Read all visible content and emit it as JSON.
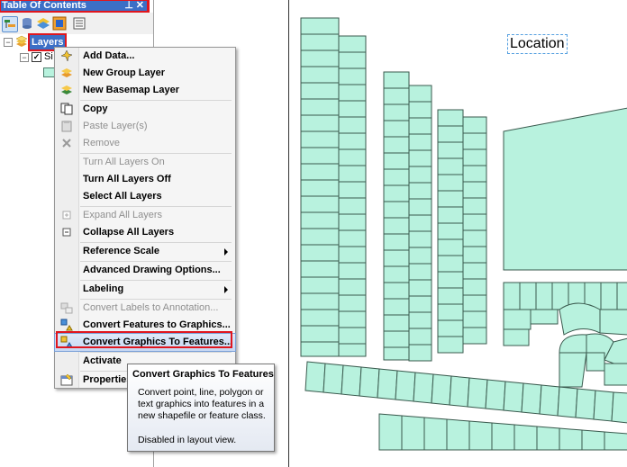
{
  "toc": {
    "title": "Table Of Contents",
    "pin_glyph": "⊥",
    "close_glyph": "✕",
    "toolbar_icons": [
      "list-by-drawing-order-icon",
      "list-by-source-icon",
      "list-by-visibility-icon",
      "list-by-selection-icon",
      "options-icon"
    ],
    "tree": {
      "layers_label": "Layers",
      "child_label": "Si",
      "expander_open": "−",
      "check_mark": "✓"
    }
  },
  "map": {
    "location_label": "Location",
    "parcel_fill": "#b8f2de",
    "parcel_stroke": "#3a5a4e"
  },
  "context_menu": {
    "items": [
      {
        "label": "Add Data...",
        "icon": "add-data-icon",
        "disabled": false
      },
      {
        "label": "New Group Layer",
        "icon": "group-layer-icon",
        "disabled": false
      },
      {
        "label": "New Basemap Layer",
        "icon": "basemap-layer-icon",
        "disabled": false
      },
      {
        "label": "Copy",
        "icon": "copy-icon",
        "disabled": false
      },
      {
        "label": "Paste Layer(s)",
        "icon": "paste-icon",
        "disabled": true
      },
      {
        "label": "Remove",
        "icon": "remove-icon",
        "disabled": true
      },
      {
        "label": "Turn All Layers On",
        "icon": "",
        "disabled": true
      },
      {
        "label": "Turn All Layers Off",
        "icon": "",
        "disabled": false
      },
      {
        "label": "Select All Layers",
        "icon": "",
        "disabled": false
      },
      {
        "label": "Expand All Layers",
        "icon": "expand-icon",
        "disabled": true
      },
      {
        "label": "Collapse All Layers",
        "icon": "collapse-icon",
        "disabled": false
      },
      {
        "label": "Reference Scale",
        "icon": "",
        "disabled": false,
        "submenu": true
      },
      {
        "label": "Advanced Drawing Options...",
        "icon": "",
        "disabled": false
      },
      {
        "label": "Labeling",
        "icon": "",
        "disabled": false,
        "submenu": true
      },
      {
        "label": "Convert Labels to Annotation...",
        "icon": "convert-labels-icon",
        "disabled": true
      },
      {
        "label": "Convert Features to Graphics...",
        "icon": "features-to-graphics-icon",
        "disabled": false
      },
      {
        "label": "Convert Graphics To Features...",
        "icon": "graphics-to-features-icon",
        "disabled": false,
        "highlighted": true
      },
      {
        "label": "Activate",
        "icon": "",
        "disabled": false
      },
      {
        "label": "Properties...",
        "icon": "properties-icon",
        "disabled": false
      }
    ]
  },
  "tooltip": {
    "title": "Convert Graphics To Features",
    "body": "Convert point, line, polygon or text graphics into features in a new shapefile or feature class.",
    "note": "Disabled in layout view."
  },
  "colors": {
    "highlight_red": "#e0161e",
    "title_blue": "#3c6fc6"
  }
}
